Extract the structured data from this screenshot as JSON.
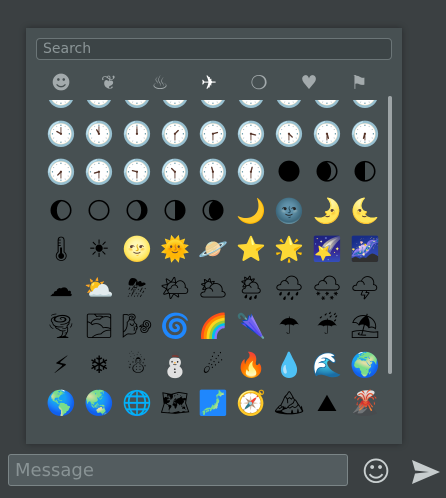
{
  "search": {
    "placeholder": "Search",
    "value": ""
  },
  "tabs": [
    {
      "name": "smileys",
      "icon": "☻",
      "active": false
    },
    {
      "name": "nature",
      "icon": "❦",
      "active": false
    },
    {
      "name": "food",
      "icon": "♨",
      "active": false
    },
    {
      "name": "travel",
      "icon": "✈",
      "active": true
    },
    {
      "name": "objects",
      "icon": "❍",
      "active": false
    },
    {
      "name": "symbols",
      "icon": "♥",
      "active": false
    },
    {
      "name": "flags",
      "icon": "⚑",
      "active": false
    }
  ],
  "emoji_rows": [
    [
      "🕐",
      "🕑",
      "🕒",
      "🕓",
      "🕔",
      "🕕",
      "🕖",
      "🕗",
      "🕘"
    ],
    [
      "🕙",
      "🕚",
      "🕛",
      "🕜",
      "🕝",
      "🕞",
      "🕟",
      "🕠",
      "🕡"
    ],
    [
      "🕢",
      "🕣",
      "🕤",
      "🕥",
      "🕦",
      "🕧",
      "🌑",
      "🌒",
      "🌓"
    ],
    [
      "🌔",
      "🌕",
      "🌖",
      "🌗",
      "🌘",
      "🌙",
      "🌚",
      "🌛",
      "🌜"
    ],
    [
      "🌡",
      "☀",
      "🌝",
      "🌞",
      "🪐",
      "⭐",
      "🌟",
      "🌠",
      "🌌"
    ],
    [
      "☁",
      "⛅",
      "⛈",
      "🌤",
      "🌥",
      "🌦",
      "🌧",
      "🌨",
      "🌩"
    ],
    [
      "🌪",
      "🌫",
      "🌬",
      "🌀",
      "🌈",
      "🌂",
      "☂",
      "☔",
      "⛱"
    ],
    [
      "⚡",
      "❄",
      "☃",
      "⛄",
      "☄",
      "🔥",
      "💧",
      "🌊",
      "🌍"
    ],
    [
      "🌎",
      "🌏",
      "🌐",
      "🗺",
      "🗾",
      "🧭",
      "🏔",
      "⛰",
      "🌋"
    ]
  ],
  "compose": {
    "placeholder": "Message",
    "value": ""
  },
  "emoji_button_icon": "☺",
  "send_button_icon": "send-arrow"
}
